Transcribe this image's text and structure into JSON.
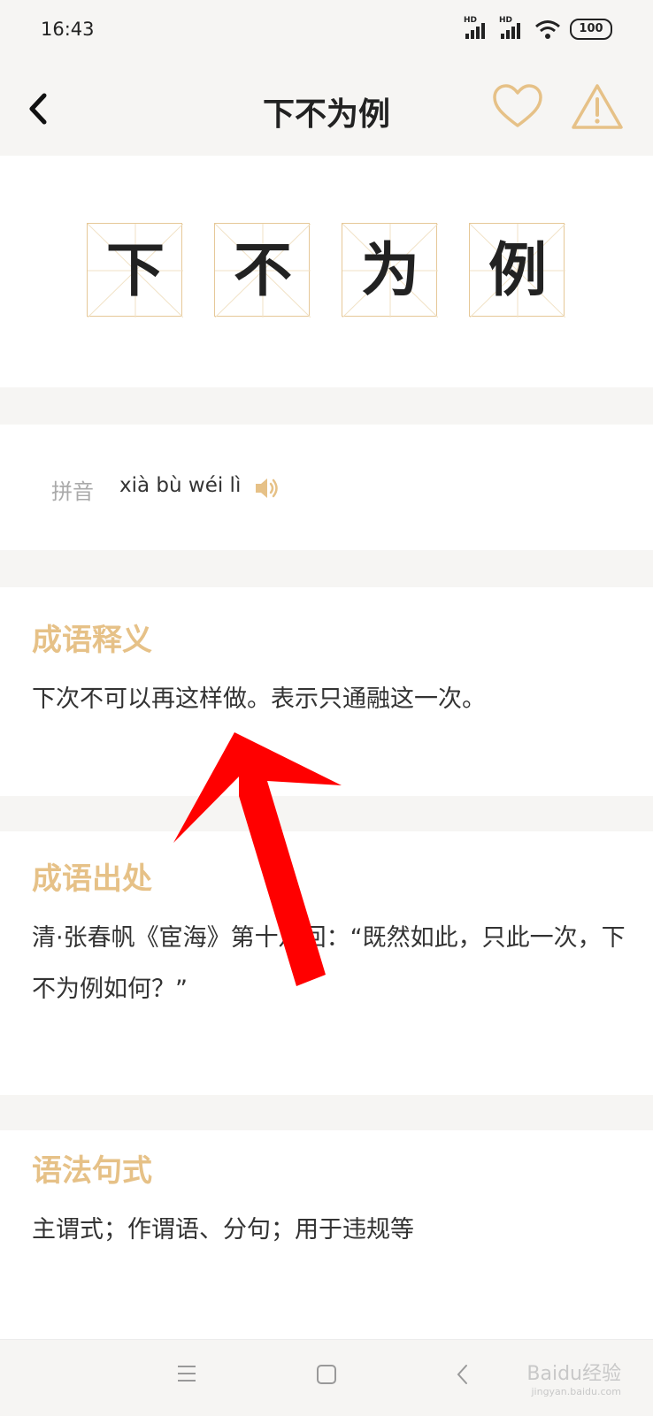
{
  "status": {
    "time": "16:43",
    "signal1": "HD",
    "signal2": "HD",
    "battery": "100"
  },
  "header": {
    "title": "下不为例"
  },
  "idiom": {
    "chars": [
      "下",
      "不",
      "为",
      "例"
    ]
  },
  "pinyin": {
    "label": "拼音",
    "value": "xià bù wéi lì"
  },
  "meaning": {
    "title": "成语释义",
    "text": "下次不可以再这样做。表示只通融这一次。"
  },
  "origin": {
    "title": "成语出处",
    "text": "清·张春帆《宦海》第十八回：“既然如此，只此一次，下不为例如何？”"
  },
  "grammar": {
    "title": "语法句式",
    "text": "主谓式；作谓语、分句；用于违规等"
  },
  "watermark": {
    "brand": "Baidu经验",
    "domain": "jingyan.baidu.com"
  },
  "colors": {
    "accent": "#e6c187",
    "annotation_arrow": "#ff0000"
  }
}
